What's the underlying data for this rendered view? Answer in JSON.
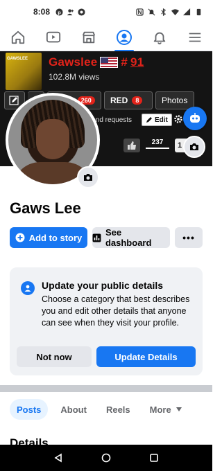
{
  "status_bar": {
    "time": "8:08",
    "left_icons": [
      "pinterest-icon",
      "add-user-icon",
      "chrome-icon"
    ],
    "right_icons": [
      "nfc-icon",
      "mute-icon",
      "bluetooth-icon",
      "wifi-icon",
      "signal-icon",
      "battery-icon"
    ]
  },
  "top_nav": {
    "items": [
      "home-icon",
      "watch-icon",
      "marketplace-icon",
      "profile-icon",
      "notifications-icon",
      "menu-icon"
    ],
    "active": "profile-icon"
  },
  "cover": {
    "thumb_text": "GAWSLEE",
    "title": "Gawslee",
    "hashtag_prefix": "#",
    "hashtag_number": "91",
    "views": "102.8M views",
    "tabs": [
      {
        "label": "ideos",
        "badge": "260"
      },
      {
        "label": "RED",
        "badge": "8"
      },
      {
        "label": "Photos",
        "badge": ""
      }
    ],
    "friend_requests": "iend requests",
    "edit_label": "Edit",
    "like_count": "237",
    "second_count": "1"
  },
  "profile": {
    "name": "Gaws Lee"
  },
  "actions": {
    "add_story": "Add to story",
    "dashboard": "See dashboard",
    "more": "•••"
  },
  "details_card": {
    "title": "Update your public details",
    "body": "Choose a category that best describes you and edit other details that anyone can see when they visit your profile.",
    "not_now": "Not now",
    "update": "Update Details"
  },
  "profile_tabs": {
    "posts": "Posts",
    "about": "About",
    "reels": "Reels",
    "more": "More"
  },
  "details_heading": "Details",
  "colors": {
    "accent": "#1877f2",
    "cover_red": "#e2231a",
    "surface": "#f0f2f5"
  }
}
